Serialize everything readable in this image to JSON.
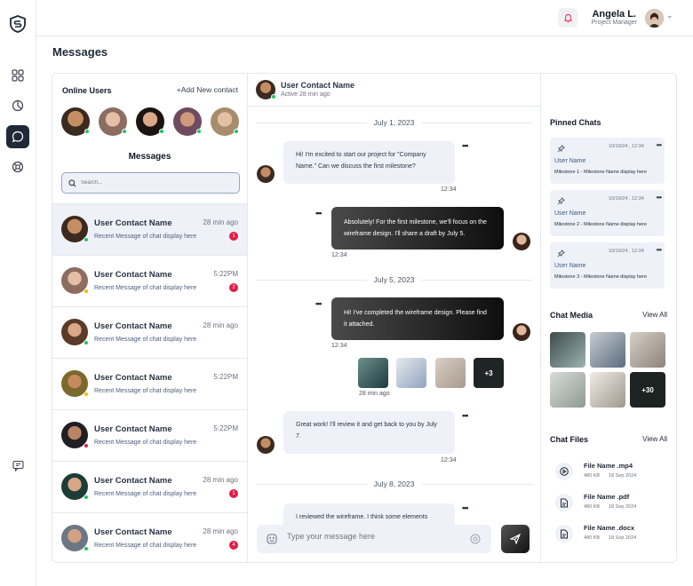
{
  "header": {
    "user_name": "Angela L.",
    "user_role": "Project Manager"
  },
  "page": {
    "title": "Messages"
  },
  "contacts_panel": {
    "online_title": "Online Users",
    "add_contact": "+Add New contact",
    "messages_title": "Messages",
    "search_placeholder": "Search...",
    "contacts": [
      {
        "name": "User Contact Name",
        "time": "28 min ago",
        "preview": "Recent Message of chat display here",
        "unread": "1",
        "status": "online"
      },
      {
        "name": "User Contact Name",
        "time": "5:22PM",
        "preview": "Recent Message of chat display here",
        "unread": "2",
        "status": "away"
      },
      {
        "name": "User Contact Name",
        "time": "28 min ago",
        "preview": "Recent Message of chat display here",
        "unread": "",
        "status": "online"
      },
      {
        "name": "User Contact Name",
        "time": "5:22PM",
        "preview": "Recent Message of chat display here",
        "unread": "",
        "status": "away"
      },
      {
        "name": "User Contact Name",
        "time": "5:22PM",
        "preview": "Recent Message of chat display here",
        "unread": "",
        "status": "busy"
      },
      {
        "name": "User Contact Name",
        "time": "28 min ago",
        "preview": "Recent Message of chat display here",
        "unread": "1",
        "status": "online"
      },
      {
        "name": "User Contact Name",
        "time": "28 min ago",
        "preview": "Recent Message of chat display here",
        "unread": "4",
        "status": "online"
      }
    ]
  },
  "chat": {
    "contact_name": "User Contact Name",
    "contact_status": "Active 28 min ago",
    "days": [
      "July 1, 2023",
      "July 5, 2023",
      "July 8, 2023"
    ],
    "messages": [
      {
        "text": "Hi! I'm excited to start our project for \"Company Name.\" Can we discuss the first milestone?",
        "time": "12:34"
      },
      {
        "text": "Absolutely! For the first milestone, we'll focus on the wireframe design. I'll share a draft by July 5.",
        "time": "12:34"
      },
      {
        "text": "Hi! I've completed the wireframe design. Please find it attached.",
        "time": "12:34"
      },
      {
        "text": "Great work! I'll review it and get back to you by July 7.",
        "time": "12:34"
      },
      {
        "text": "I reviewed the wireframe. I think some elements",
        "time": ""
      }
    ],
    "attachments_more": "+3",
    "attachments_time": "28 min ago",
    "composer_placeholder": "Type your message here"
  },
  "side": {
    "pinned_title": "Pinned Chats",
    "pinned": [
      {
        "date": "10/16/24 , 12:34",
        "name": "User Name",
        "text": "Milestone 1 - Milestone Name display here"
      },
      {
        "date": "10/16/24 , 12:34",
        "name": "User Name",
        "text": "Milestone 2 - Milestone Name display here"
      },
      {
        "date": "10/16/24 , 12:34",
        "name": "User Name",
        "text": "Milestone 3 - Milestone Name display here"
      }
    ],
    "media_title": "Chat Media",
    "media_view_all": "View All",
    "media_more": "+30",
    "files_title": "Chat Files",
    "files_view_all": "View All",
    "files": [
      {
        "name": "File Name .mp4",
        "size": "480 KB",
        "date": "18 Sep 2024",
        "icon": "play-icon"
      },
      {
        "name": "File Name .pdf",
        "size": "480 KB",
        "date": "18 Sep 2024",
        "icon": "document-icon"
      },
      {
        "name": "File Name .docx",
        "size": "480 KB",
        "date": "18 Sep 2024",
        "icon": "document-icon"
      }
    ]
  },
  "colors": {
    "accent_dark": "#1f2937",
    "online": "#22c55e",
    "away": "#f5b800",
    "busy": "#e11d48",
    "badge": "#e11d48",
    "panel_bg": "#eef1f7"
  }
}
